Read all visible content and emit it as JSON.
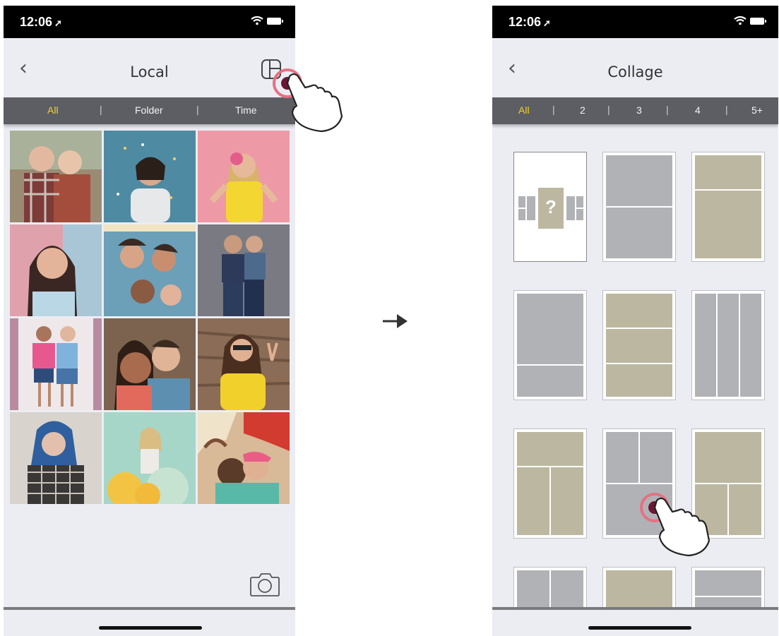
{
  "left_screen": {
    "status": {
      "time": "12:06",
      "location_icon": "location-arrow-icon",
      "wifi_icon": "wifi-icon",
      "battery_icon": "battery-icon"
    },
    "nav": {
      "back_icon": "chevron-left-icon",
      "title": "Local",
      "collage_icon": "collage-layout-icon"
    },
    "filters": [
      {
        "label": "All",
        "active": true
      },
      {
        "label": "Folder",
        "active": false
      },
      {
        "label": "Time",
        "active": false
      }
    ],
    "separator": "|",
    "photos": [
      {
        "subject": "two-girls-hugging",
        "color": "#8c6a5a"
      },
      {
        "subject": "girl-blowing-confetti",
        "color": "#4e7f95"
      },
      {
        "subject": "woman-with-pink-camera",
        "color": "#e69aa2"
      },
      {
        "subject": "smiling-girl-pink-bg",
        "color": "#d89fa8"
      },
      {
        "subject": "friends-lying-circle",
        "color": "#6f90a5"
      },
      {
        "subject": "couple-standing",
        "color": "#6d7079"
      },
      {
        "subject": "two-girls-backpacks",
        "color": "#b8a6b0"
      },
      {
        "subject": "couple-selfie",
        "color": "#7a5c4b"
      },
      {
        "subject": "woman-yellow-sweater",
        "color": "#8f6d53"
      },
      {
        "subject": "blue-hair-woman",
        "color": "#3c4d63"
      },
      {
        "subject": "woman-balloons",
        "color": "#9fcfc0"
      },
      {
        "subject": "couple-kissing-floral",
        "color": "#c29b71"
      }
    ],
    "camera_icon": "camera-icon"
  },
  "right_screen": {
    "status": {
      "time": "12:06",
      "location_icon": "location-arrow-icon",
      "wifi_icon": "wifi-icon",
      "battery_icon": "battery-icon"
    },
    "nav": {
      "back_icon": "chevron-left-icon",
      "title": "Collage"
    },
    "filters": [
      {
        "label": "All",
        "active": true
      },
      {
        "label": "2",
        "active": false
      },
      {
        "label": "3",
        "active": false
      },
      {
        "label": "4",
        "active": false
      },
      {
        "label": "5+",
        "active": false
      }
    ],
    "separator": "|",
    "templates": [
      {
        "name": "random-collage",
        "label": "?"
      },
      {
        "name": "two-horizontal-gray"
      },
      {
        "name": "two-horizontal-khaki"
      },
      {
        "name": "two-split-gray"
      },
      {
        "name": "three-horizontal-khaki"
      },
      {
        "name": "three-vertical-gray"
      },
      {
        "name": "top-plus-two-khaki"
      },
      {
        "name": "two-plus-bottom-gray"
      },
      {
        "name": "top-two-bottom-khaki"
      },
      {
        "name": "quad-gray-partial"
      },
      {
        "name": "single-khaki-partial"
      },
      {
        "name": "split-gray-partial"
      }
    ],
    "colors": {
      "gray": "#b1b2b6",
      "khaki": "#bcb7a0"
    }
  },
  "transition_icon": "arrow-right-icon",
  "tap_indicator_icon": "tap-hand-icon",
  "colors": {
    "filter_bar": "#5d5e63",
    "filter_active": "#f0d130",
    "screen_bg": "#ecedf3",
    "tap_ring": "#e57182"
  }
}
